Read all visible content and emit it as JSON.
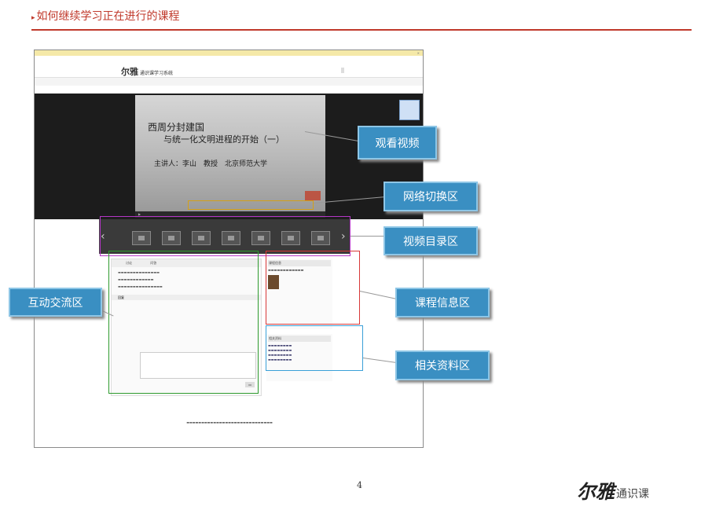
{
  "slide": {
    "title": "如何继续学习正在进行的课程",
    "page_number": "4"
  },
  "screenshot": {
    "site_logo": "尔雅",
    "site_name": "通识课学习系统",
    "video_title_line1": "西周分封建国",
    "video_title_line2": "与统一化文明进程的开始（一）",
    "video_speaker": "主讲人：李山　教授　北京师范大学",
    "comm_tabs": [
      "讨论",
      "问答"
    ],
    "reply_title": "回复",
    "info_title": "课程信息",
    "resource_title": "相关资料"
  },
  "callouts": {
    "watch_video": "观看视频",
    "network_switch": "网络切换区",
    "video_catalog": "视频目录区",
    "interaction": "互动交流区",
    "course_info": "课程信息区",
    "related_materials": "相关资料区"
  },
  "brand": {
    "logo_mark": "尔雅",
    "label": "通识课"
  },
  "colors": {
    "title_red": "#c0392b",
    "callout_blue": "#3a8fc2",
    "highlight_yellow": "#d4a017",
    "highlight_purple": "#b536c7",
    "highlight_green": "#2e9b2e",
    "highlight_red": "#d83838",
    "highlight_blue": "#3aa0d8"
  }
}
